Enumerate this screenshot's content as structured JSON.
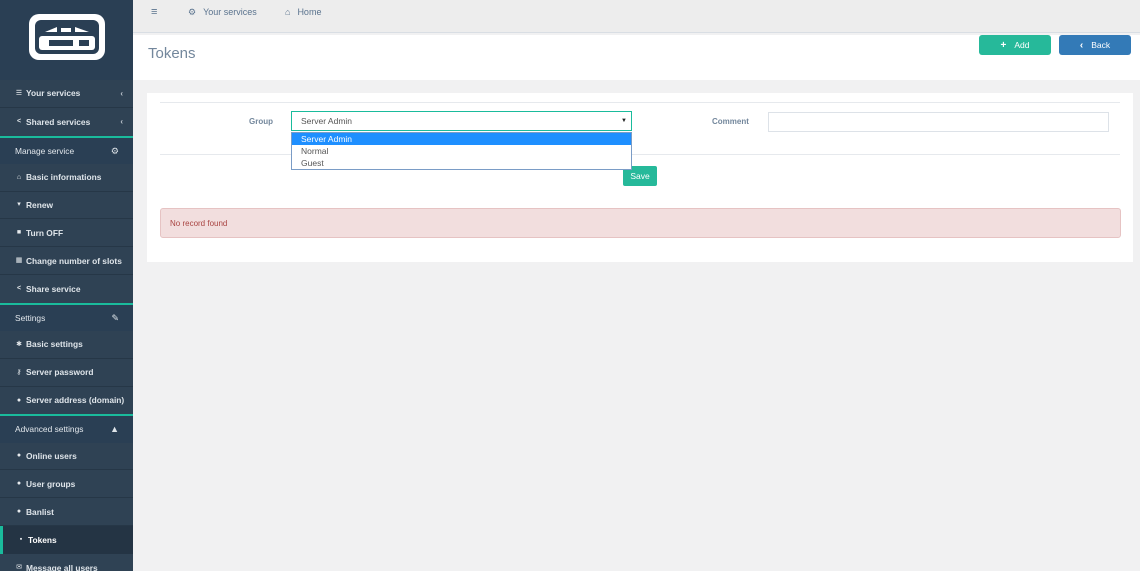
{
  "sidebar": {
    "items": [
      {
        "label": "Your services",
        "icon": "list-icon"
      },
      {
        "label": "Shared services",
        "icon": "share-icon"
      }
    ],
    "manage_header": "Manage service",
    "manage_items": [
      {
        "label": "Basic informations",
        "icon": "home-icon"
      },
      {
        "label": "Renew",
        "icon": "cart-icon"
      },
      {
        "label": "Turn OFF",
        "icon": "stop-icon"
      },
      {
        "label": "Change number of slots",
        "icon": "grid-icon"
      },
      {
        "label": "Share service",
        "icon": "share-icon"
      }
    ],
    "settings_header": "Settings",
    "settings_items": [
      {
        "label": "Basic settings",
        "icon": "gear-icon"
      },
      {
        "label": "Server password",
        "icon": "key-icon"
      },
      {
        "label": "Server address (domain)",
        "icon": "globe-icon"
      }
    ],
    "advanced_header": "Advanced settings",
    "advanced_items": [
      {
        "label": "Online users",
        "icon": "user-icon"
      },
      {
        "label": "User groups",
        "icon": "users-icon"
      },
      {
        "label": "Banlist",
        "icon": "user-ban-icon"
      },
      {
        "label": "Tokens",
        "icon": "lock-icon"
      },
      {
        "label": "Message all users",
        "icon": "message-icon"
      }
    ]
  },
  "topbar": {
    "menu_icon": "hamburger-icon",
    "your_services": "Your services",
    "home": "Home"
  },
  "page": {
    "title": "Tokens",
    "add_label": "Add",
    "back_label": "Back"
  },
  "form": {
    "group_label": "Group",
    "group_value": "Server Admin",
    "group_options": [
      "Server Admin",
      "Normal",
      "Guest"
    ],
    "comment_label": "Comment",
    "comment_value": "",
    "save_label": "Save"
  },
  "alert": {
    "message": "No record found"
  },
  "colors": {
    "accent": "#1abb9c",
    "sidebar": "#2a3f54",
    "primary": "#337ab7",
    "success": "#26b99a"
  }
}
